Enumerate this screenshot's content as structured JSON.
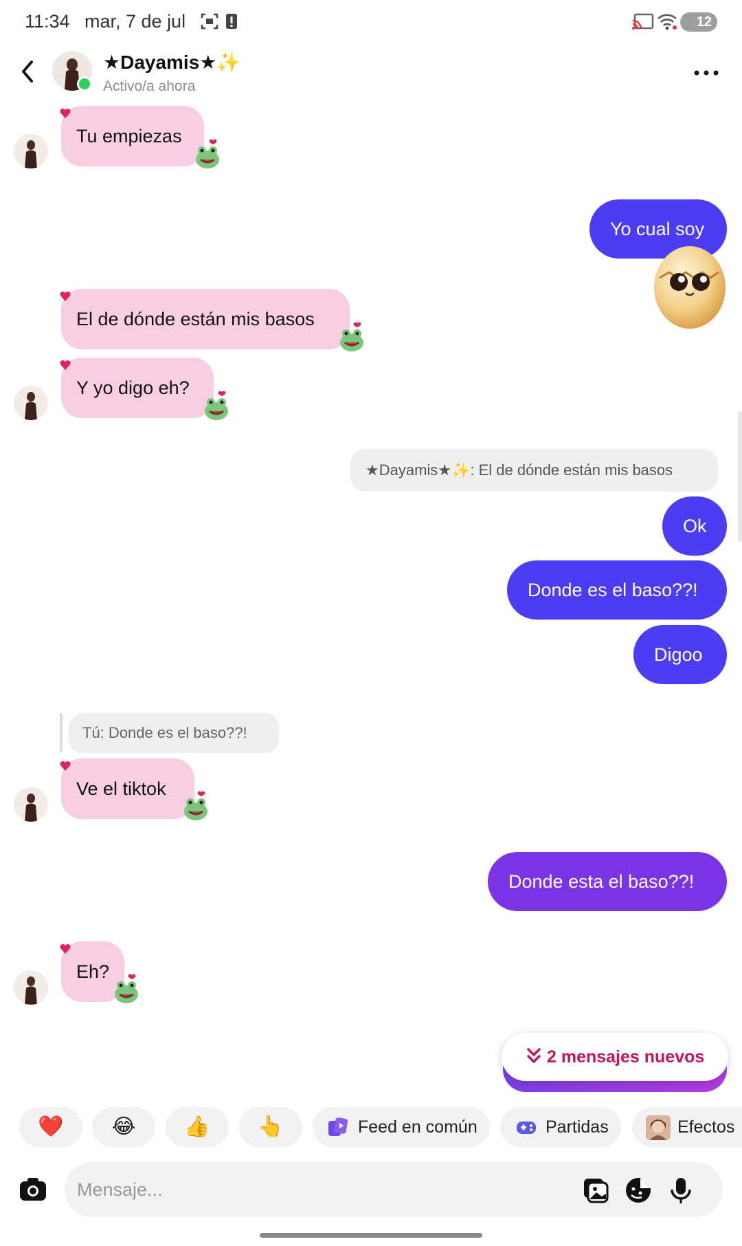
{
  "status_bar": {
    "time": "11:34",
    "date": "mar, 7 de jul",
    "battery": "12"
  },
  "header": {
    "name": "★Dayamis★✨",
    "status": "Activo/a ahora"
  },
  "messages": {
    "m1": "Tu empiezas",
    "m2": "Yo cual soy",
    "m3": "El de dónde están mis basos",
    "m4": "Y yo digo eh?",
    "reply_quote_1": "★Dayamis★✨: El de dónde están mis basos",
    "m5": "Ok",
    "m6": "Donde es el baso??!",
    "m7": "Digoo",
    "reply_quote_2": "Tú: Donde es el baso??!",
    "m8": "Ve el tiktok",
    "m9": "Donde esta el baso??!",
    "m10": "Eh?"
  },
  "new_messages": "2 mensajes nuevos",
  "quick_reactions": {
    "heart": "❤️",
    "laugh": "😂",
    "thumbs": "👍",
    "point": "👆",
    "feed": "Feed en común",
    "games": "Partidas",
    "effects": "Efectos"
  },
  "composer": {
    "placeholder": "Mensaje..."
  },
  "colors": {
    "incoming_bubble": "#f8cee3",
    "outgoing_blue": "#4c3df2",
    "outgoing_purple": "#7a33e6",
    "accent_red": "#c5175a",
    "online": "#2ed158"
  }
}
